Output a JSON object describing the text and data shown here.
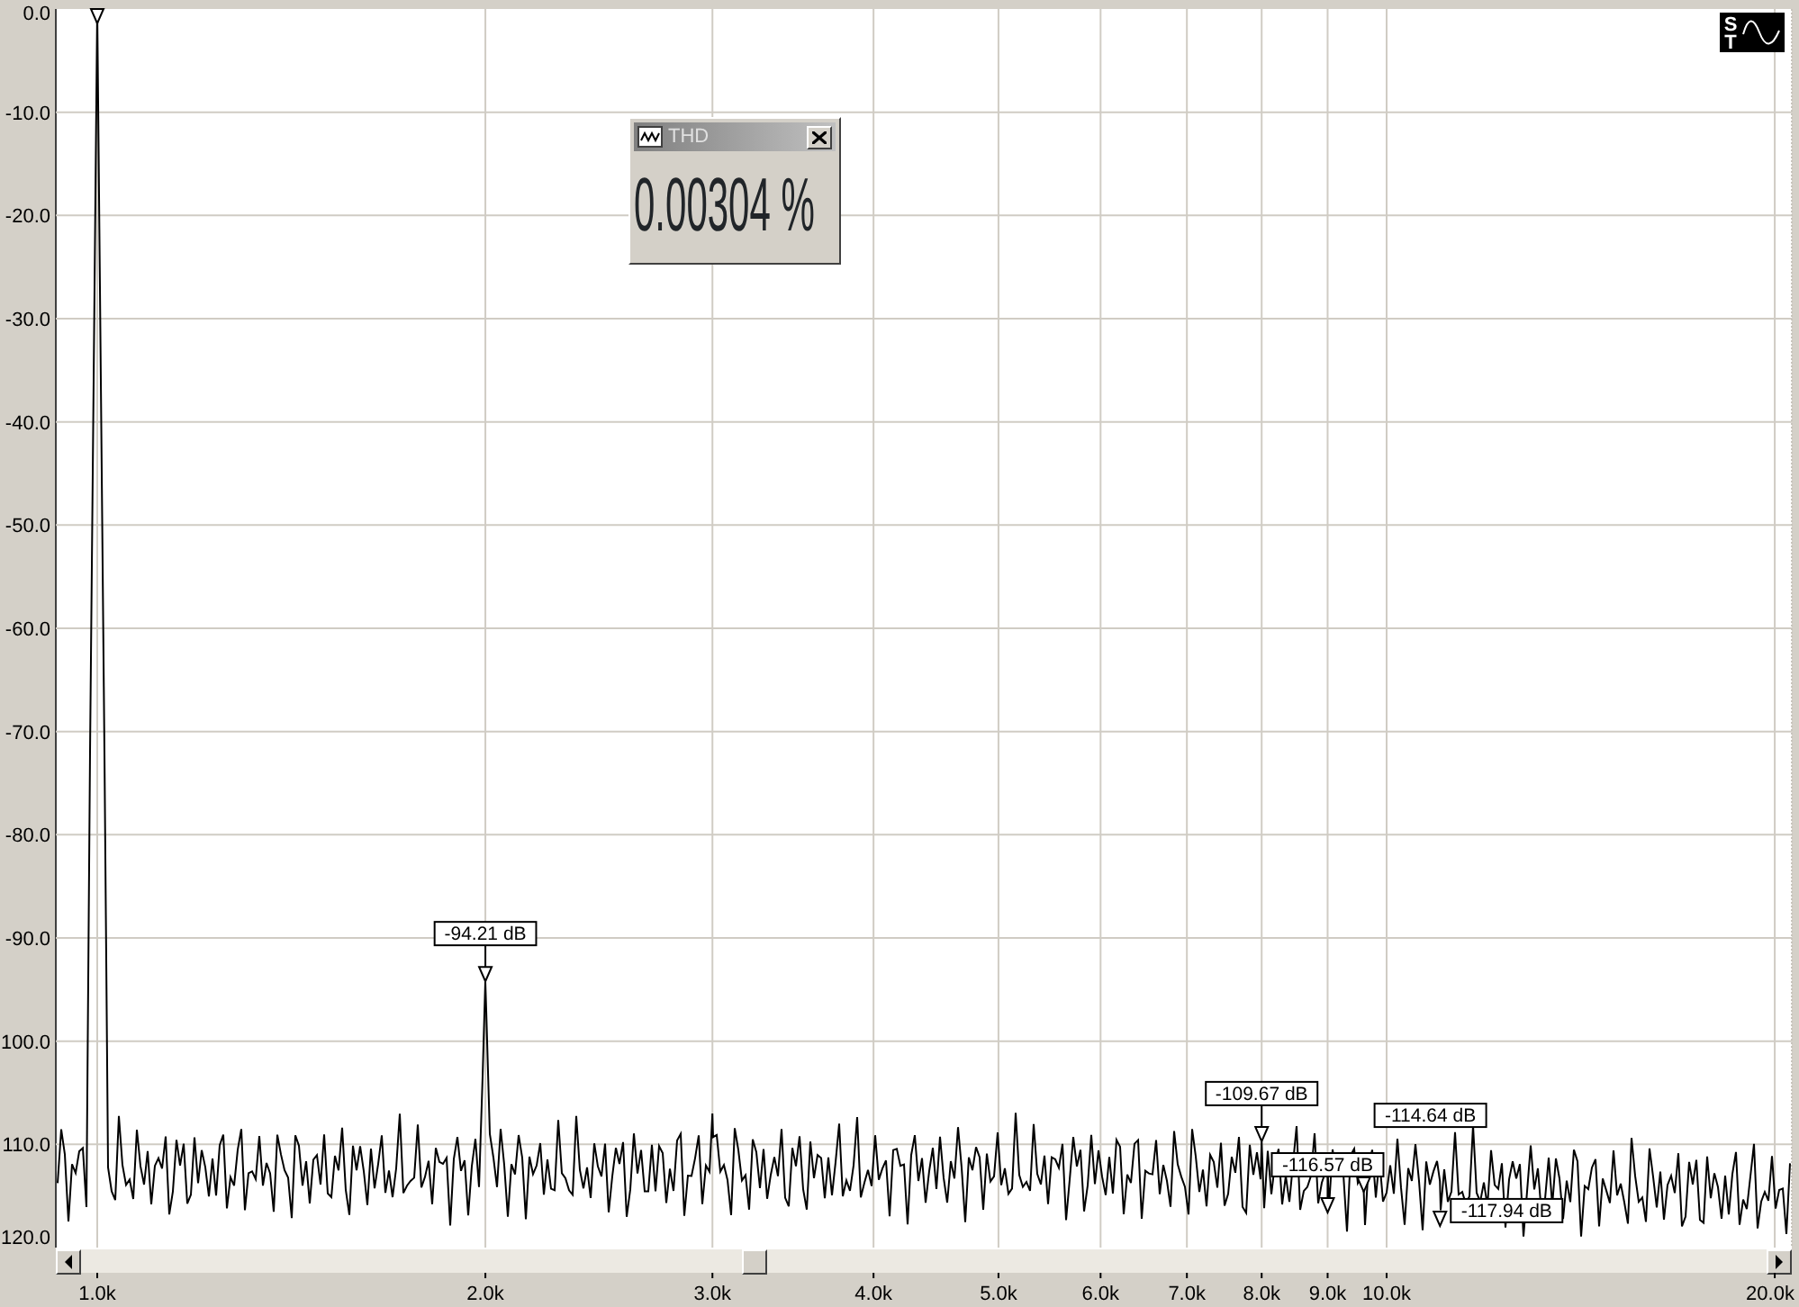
{
  "toolbar_button": {
    "letters": [
      "S",
      "T"
    ]
  },
  "thd_window": {
    "title": "THD",
    "value": "0.00304 %"
  },
  "spectrum_plot": {
    "y_axis_labels": [
      "0.0",
      "-10.0",
      "-20.0",
      "-30.0",
      "-40.0",
      "-50.0",
      "-60.0",
      "-70.0",
      "-80.0",
      "-90.0",
      "100.0",
      "110.0",
      "120.0"
    ],
    "x_axis_labels": [
      "1.0k",
      "2.0k",
      "3.0k",
      "4.0k",
      "5.0k",
      "6.0k",
      "7.0k",
      "8.0k",
      "9.0k",
      "10.0k",
      "20.0k"
    ],
    "peak_labels": [
      "-94.21 dB",
      "-109.67 dB",
      "-116.57 dB",
      "-114.64 dB",
      "-117.94 dB"
    ]
  }
}
